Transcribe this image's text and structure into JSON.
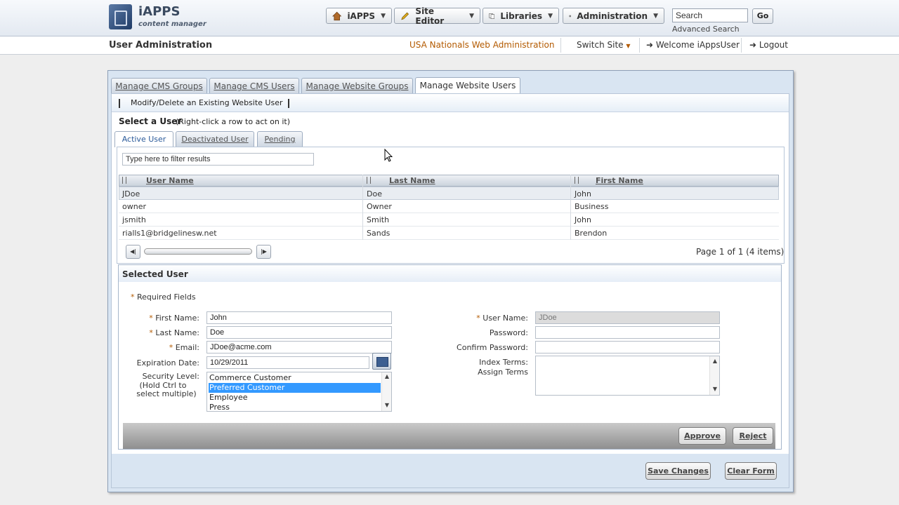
{
  "header": {
    "brand": "iAPPS",
    "brand_sub": "content manager",
    "nav": [
      {
        "label": "iAPPS",
        "icon": "home-icon"
      },
      {
        "label": "Site Editor",
        "icon": "pencil-icon"
      },
      {
        "label": "Libraries",
        "icon": "copy-icon"
      },
      {
        "label": "Administration",
        "icon": "gear-icon"
      }
    ],
    "search_value": "Search",
    "go_label": "Go",
    "advanced_search": "Advanced Search"
  },
  "subbar": {
    "page_title": "User Administration",
    "site_name": "USA Nationals Web Administration",
    "switch_site": "Switch Site",
    "welcome": "Welcome iAppsUser",
    "logout": "Logout"
  },
  "tabs": [
    "Manage CMS Groups",
    "Manage CMS Users",
    "Manage Website Groups",
    "Manage Website Users"
  ],
  "action_link": "Modify/Delete an Existing Website User",
  "select": {
    "label": "Select a User",
    "hint": "(Right-click a row to act on it)"
  },
  "subtabs": [
    "Active User",
    "Deactivated User",
    "Pending"
  ],
  "filter_placeholder": "Type here to filter results",
  "grid": {
    "columns": [
      "User Name",
      "Last Name",
      "First Name"
    ],
    "rows": [
      [
        "JDoe",
        "Doe",
        "John"
      ],
      [
        "owner",
        "Owner",
        "Business"
      ],
      [
        "jsmith",
        "Smith",
        "John"
      ],
      [
        "rialls1@bridgelinesw.net",
        "Sands",
        "Brendon"
      ]
    ],
    "page_info": "Page 1 of 1 (4 items)"
  },
  "selected": {
    "title": "Selected User",
    "required": "Required Fields",
    "labels": {
      "first_name": "First Name:",
      "last_name": "Last Name:",
      "email": "Email:",
      "expiration": "Expiration Date:",
      "security": "Security Level:",
      "security_hint1": "(Hold Ctrl to",
      "security_hint2": "select multiple)",
      "user_name": "User Name:",
      "password": "Password:",
      "confirm": "Confirm Password:",
      "index_terms": "Index Terms:",
      "assign_terms": "Assign Terms"
    },
    "values": {
      "first_name": "John",
      "last_name": "Doe",
      "email": "JDoe@acme.com",
      "expiration": "10/29/2011",
      "user_name": "JDoe",
      "password": "",
      "confirm": ""
    },
    "security_options": [
      "Commerce Customer",
      "Preferred Customer",
      "Employee",
      "Press"
    ],
    "security_selected": "Preferred Customer",
    "approve": "Approve",
    "reject": "Reject"
  },
  "footer": {
    "save": "Save Changes",
    "clear": "Clear Form"
  }
}
